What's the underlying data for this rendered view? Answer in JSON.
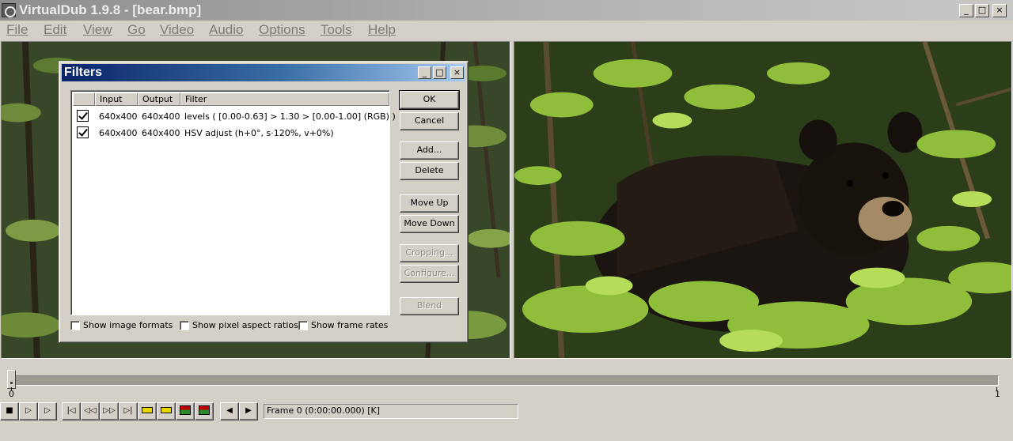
{
  "window": {
    "title": "VirtualDub 1.9.8 - [bear.bmp]",
    "minimize": "_",
    "maximize": "□",
    "close": "×"
  },
  "menu": [
    "File",
    "Edit",
    "View",
    "Go",
    "Video",
    "Audio",
    "Options",
    "Tools",
    "Help"
  ],
  "filters_dialog": {
    "title": "Filters",
    "minimize": "_",
    "maximize": "□",
    "close": "×",
    "columns": [
      "Input",
      "Output",
      "Filter"
    ],
    "rows": [
      {
        "checked": true,
        "input": "640x400",
        "output": "640x400",
        "filter": "levels ( [0.00-0.63] > 1.30 > [0.00-1.00] (RGB) )"
      },
      {
        "checked": true,
        "input": "640x400",
        "output": "640x400",
        "filter": "HSV adjust (h+0°, s·120%, v+0%)"
      }
    ],
    "buttons": {
      "ok": "OK",
      "cancel": "Cancel",
      "add": "Add...",
      "delete": "Delete",
      "move_up": "Move Up",
      "move_down": "Move Down",
      "cropping": "Cropping...",
      "configure": "Configure...",
      "blend": "Blend"
    },
    "checkboxes": {
      "image_formats": "Show image formats",
      "pixel_aspect": "Show pixel aspect ratios",
      "frame_rates": "Show frame rates"
    }
  },
  "timeline": {
    "start_label": "0",
    "end_label": "1",
    "position": 0
  },
  "toolbar": {
    "stop": "■",
    "play_input": "▷",
    "play_output": "▷",
    "start": "|◁",
    "prev_frame": "◁◁",
    "next_frame": "▷▷",
    "end": "▷|",
    "mark_in": "◀",
    "mark_out": "▶",
    "status": "Frame 0 (0:00:00.000) [K]"
  },
  "colors": {
    "dialog_title_start": "#0a246a",
    "dialog_title_end": "#a6caf0",
    "face": "#d4d0c8"
  }
}
